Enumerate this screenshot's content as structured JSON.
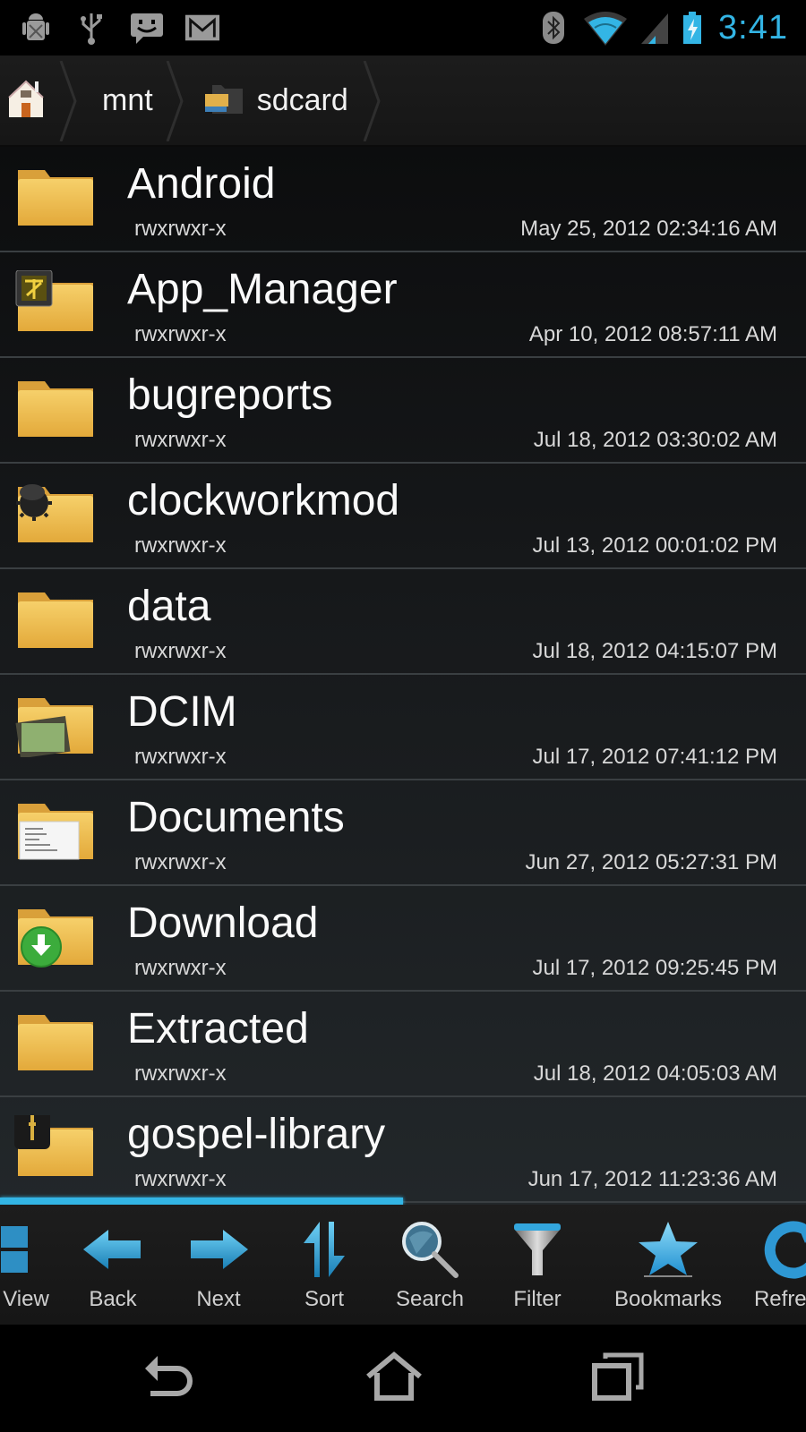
{
  "status_bar": {
    "left_icons": [
      "android-debug-icon",
      "usb-icon",
      "messaging-icon",
      "gmail-icon"
    ],
    "right_icons": [
      "bluetooth-icon",
      "wifi-icon",
      "cell-signal-icon",
      "battery-charging-icon"
    ],
    "time": "3:41",
    "accent_color": "#33b5e5"
  },
  "breadcrumb": {
    "items": [
      {
        "label": "",
        "icon": "home-icon"
      },
      {
        "label": "mnt",
        "icon": ""
      },
      {
        "label": "sdcard",
        "icon": "sdcard-icon"
      }
    ]
  },
  "files": [
    {
      "name": "Android",
      "permissions": "rwxrwxr-x",
      "modified": "May 25, 2012 02:34:16 AM",
      "icon": "folder-icon"
    },
    {
      "name": "App_Manager",
      "permissions": "rwxrwxr-x",
      "modified": "Apr 10, 2012 08:57:11 AM",
      "icon": "app-manager-folder-icon"
    },
    {
      "name": "bugreports",
      "permissions": "rwxrwxr-x",
      "modified": "Jul 18, 2012 03:30:02 AM",
      "icon": "folder-icon"
    },
    {
      "name": "clockworkmod",
      "permissions": "rwxrwxr-x",
      "modified": "Jul 13, 2012 00:01:02 PM",
      "icon": "clockworkmod-folder-icon"
    },
    {
      "name": "data",
      "permissions": "rwxrwxr-x",
      "modified": "Jul 18, 2012 04:15:07 PM",
      "icon": "folder-icon"
    },
    {
      "name": "DCIM",
      "permissions": "rwxrwxr-x",
      "modified": "Jul 17, 2012 07:41:12 PM",
      "icon": "pictures-folder-icon"
    },
    {
      "name": "Documents",
      "permissions": "rwxrwxr-x",
      "modified": "Jun 27, 2012 05:27:31 PM",
      "icon": "documents-folder-icon"
    },
    {
      "name": "Download",
      "permissions": "rwxrwxr-x",
      "modified": "Jul 17, 2012 09:25:45 PM",
      "icon": "download-folder-icon"
    },
    {
      "name": "Extracted",
      "permissions": "rwxrwxr-x",
      "modified": "Jul 18, 2012 04:05:03 AM",
      "icon": "folder-icon"
    },
    {
      "name": "gospel-library",
      "permissions": "rwxrwxr-x",
      "modified": "Jun 17, 2012 11:23:36 AM",
      "icon": "gospel-library-folder-icon"
    }
  ],
  "scroll": {
    "position_fraction": 0.5
  },
  "toolbar": {
    "items": [
      {
        "label": "View",
        "icon": "grid-view-icon"
      },
      {
        "label": "Back",
        "icon": "arrow-left-icon"
      },
      {
        "label": "Next",
        "icon": "arrow-right-icon"
      },
      {
        "label": "Sort",
        "icon": "sort-icon"
      },
      {
        "label": "Search",
        "icon": "search-icon"
      },
      {
        "label": "Filter",
        "icon": "filter-icon"
      },
      {
        "label": "Bookmarks",
        "icon": "star-icon"
      },
      {
        "label": "Refresh",
        "icon": "refresh-icon"
      }
    ]
  },
  "nav_bar": {
    "buttons": [
      "back-nav-icon",
      "home-nav-icon",
      "recent-apps-icon"
    ]
  }
}
